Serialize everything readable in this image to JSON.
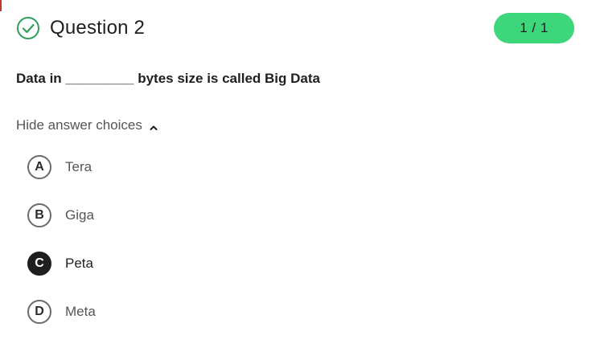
{
  "header": {
    "title": "Question 2",
    "score": "1 / 1",
    "status_icon": "check-circle-icon",
    "accent_color": "#3dd67a"
  },
  "question": {
    "text": "Data in _________ bytes size is called Big Data"
  },
  "toggle": {
    "label": "Hide answer choices",
    "icon": "chevron-up-icon"
  },
  "choices": [
    {
      "letter": "A",
      "text": "Tera",
      "selected": false
    },
    {
      "letter": "B",
      "text": "Giga",
      "selected": false
    },
    {
      "letter": "C",
      "text": "Peta",
      "selected": true
    },
    {
      "letter": "D",
      "text": "Meta",
      "selected": false
    }
  ]
}
